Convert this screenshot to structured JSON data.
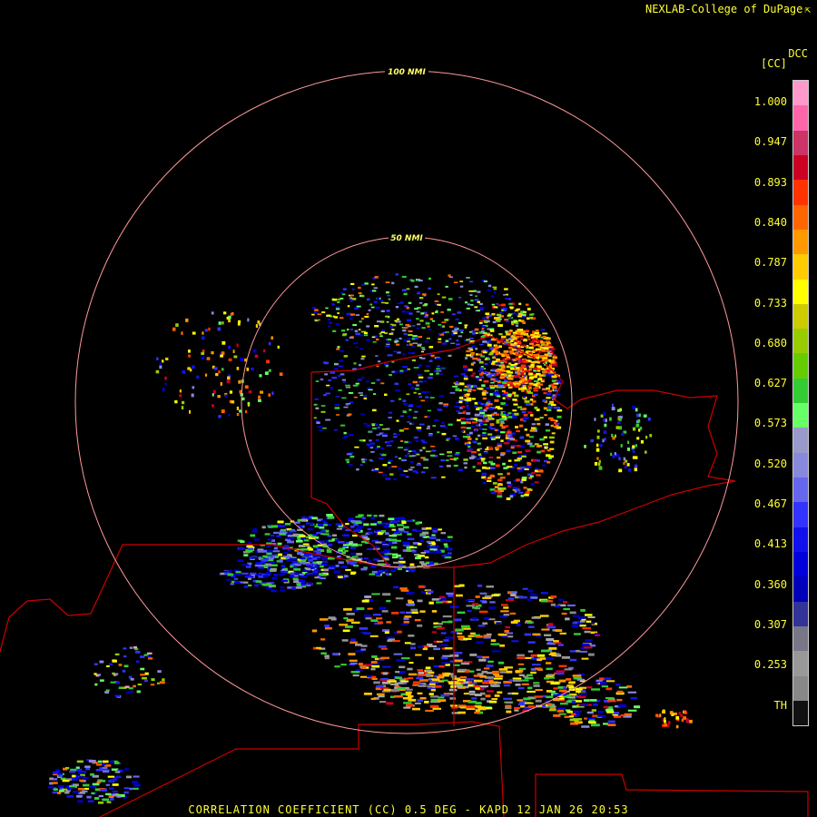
{
  "header": {
    "credit": "NEXLAB-College of DuPage"
  },
  "colorbar": {
    "product_code": "DCC",
    "unit": "[CC]",
    "ticks": [
      "1.000",
      "0.947",
      "0.893",
      "0.840",
      "0.787",
      "0.733",
      "0.680",
      "0.627",
      "0.573",
      "0.520",
      "0.467",
      "0.413",
      "0.360",
      "0.307",
      "0.253",
      "TH"
    ],
    "colors": [
      "#ff99cc",
      "#ff66aa",
      "#cc3366",
      "#cc0022",
      "#ff3300",
      "#ff6600",
      "#ff9900",
      "#ffcc00",
      "#ffff00",
      "#cccc00",
      "#99cc00",
      "#66cc00",
      "#33cc33",
      "#66ff66",
      "#9999cc",
      "#8888dd",
      "#6666ee",
      "#3333ff",
      "#1111ee",
      "#0000dd",
      "#0000bb",
      "#333399",
      "#777788",
      "#999999",
      "#888888",
      "#111111"
    ]
  },
  "map": {
    "range_rings": [
      {
        "label": "100 NMI",
        "nmi": 100
      },
      {
        "label": "50 NMI",
        "nmi": 50
      }
    ],
    "ring_color": "#ff9999",
    "border_color": "#cc0000"
  },
  "footer": {
    "caption": "CORRELATION COEFFICIENT (CC) 0.5 DEG - KAPD 12 JAN 26 20:53"
  }
}
